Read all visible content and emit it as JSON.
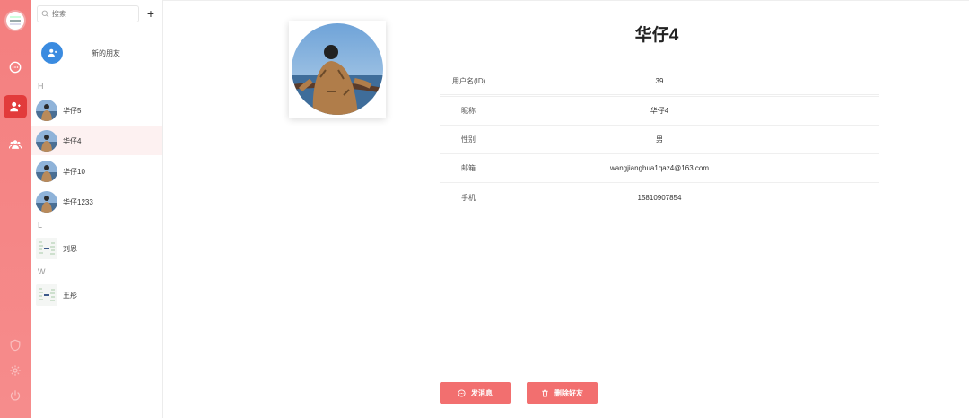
{
  "sidebar": {
    "logo_icon": "app-logo-icon",
    "nav": [
      {
        "name": "chat-icon"
      },
      {
        "name": "contacts-icon"
      },
      {
        "name": "groups-icon"
      }
    ],
    "bottom": [
      {
        "name": "shield-icon"
      },
      {
        "name": "gear-icon"
      },
      {
        "name": "power-icon"
      }
    ]
  },
  "contacts": {
    "search_placeholder": "搜索",
    "add_label": "+",
    "new_friends_label": "新的朋友",
    "groups": [
      {
        "letter": "H",
        "items": [
          "华仔5",
          "华仔4",
          "华仔10",
          "华仔1233"
        ]
      },
      {
        "letter": "L",
        "items": [
          "刘恩"
        ]
      },
      {
        "letter": "W",
        "items": [
          "王彤"
        ]
      }
    ],
    "selected": "华仔4"
  },
  "profile": {
    "display_name": "华仔4",
    "fields": [
      {
        "label": "用户名(ID)",
        "value": "39"
      },
      {
        "label": "昵称",
        "value": "华仔4"
      },
      {
        "label": "性别",
        "value": "男"
      },
      {
        "label": "邮箱",
        "value": "wangjianghua1qaz4@163.com"
      },
      {
        "label": "手机",
        "value": "15810907854"
      }
    ],
    "send_label": "发消息",
    "delete_label": "删除好友"
  },
  "colors": {
    "accent": "#f26f6f",
    "rail": "#f47f7f",
    "active_rail": "#e23b3b",
    "new_friend_icon": "#3a8be0"
  }
}
